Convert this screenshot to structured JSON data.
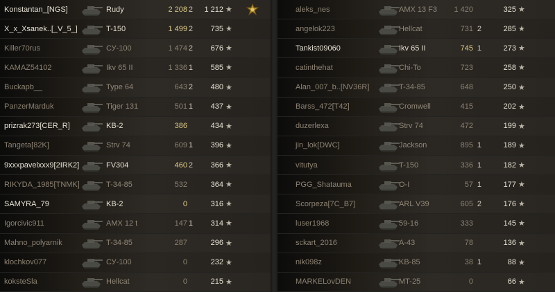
{
  "star_glyph": "★",
  "team_left": [
    {
      "player": "Konstantan_[NGS]",
      "tank": "Rudy",
      "damage": "2 208",
      "kills": "2",
      "xp": "1 212",
      "style": "bright",
      "medal": "ace-medal-icon"
    },
    {
      "player": "X_x_Xsanek..[_V_5_]",
      "tank": "T-150",
      "damage": "1 499",
      "kills": "2",
      "xp": "735",
      "style": "bright"
    },
    {
      "player": "Killer70rus",
      "tank": "СУ-100",
      "damage": "1 474",
      "kills": "2",
      "xp": "676",
      "style": "dim"
    },
    {
      "player": "KAMAZ54102",
      "tank": "Ikv 65 II",
      "damage": "1 336",
      "kills": "1",
      "xp": "585",
      "style": "dim"
    },
    {
      "player": "Buckapb__",
      "tank": "Type 64",
      "damage": "643",
      "kills": "2",
      "xp": "480",
      "style": "dim"
    },
    {
      "player": "PanzerMarduk",
      "tank": "Tiger 131",
      "damage": "501",
      "kills": "1",
      "xp": "437",
      "style": "dim"
    },
    {
      "player": "prizrak273[CER_R]",
      "tank": "KB-2",
      "damage": "386",
      "kills": "",
      "xp": "434",
      "style": "bright"
    },
    {
      "player": "Tangeta[82K]",
      "tank": "Strv 74",
      "damage": "609",
      "kills": "1",
      "xp": "396",
      "style": "dim"
    },
    {
      "player": "9xxxpavelxxx9[2IRK2]",
      "tank": "FV304",
      "damage": "460",
      "kills": "2",
      "xp": "366",
      "style": "bright"
    },
    {
      "player": "RIKYDA_1985[TNMK]",
      "tank": "T-34-85",
      "damage": "532",
      "kills": "",
      "xp": "364",
      "style": "dim"
    },
    {
      "player": "SAMYRA_79",
      "tank": "KB-2",
      "damage": "0",
      "kills": "",
      "xp": "316",
      "style": "bright"
    },
    {
      "player": "Igorcivic911",
      "tank": "AMX 12 t",
      "damage": "147",
      "kills": "1",
      "xp": "314",
      "style": "dim"
    },
    {
      "player": "Mahno_polyarnik",
      "tank": "T-34-85",
      "damage": "287",
      "kills": "",
      "xp": "296",
      "style": "dim"
    },
    {
      "player": "klochkov077",
      "tank": "СУ-100",
      "damage": "0",
      "kills": "",
      "xp": "232",
      "style": "dim"
    },
    {
      "player": "koksteSla",
      "tank": "Hellcat",
      "damage": "0",
      "kills": "",
      "xp": "215",
      "style": "dim"
    }
  ],
  "team_right": [
    {
      "player": "aleks_nes",
      "tank": "AMX 13 F3",
      "damage": "1 420",
      "kills": "",
      "xp": "325",
      "style": "dim"
    },
    {
      "player": "angelok223",
      "tank": "Hellcat",
      "damage": "731",
      "kills": "2",
      "xp": "285",
      "style": "dim"
    },
    {
      "player": "Tankist09060",
      "tank": "Ikv 65 II",
      "damage": "745",
      "kills": "1",
      "xp": "273",
      "style": "bright"
    },
    {
      "player": "catinthehat",
      "tank": "Chi-To",
      "damage": "723",
      "kills": "",
      "xp": "258",
      "style": "dim"
    },
    {
      "player": "Alan_007_b..[NV36R]",
      "tank": "T-34-85",
      "damage": "648",
      "kills": "",
      "xp": "250",
      "style": "dim"
    },
    {
      "player": "Barss_472[T42]",
      "tank": "Cromwell",
      "damage": "415",
      "kills": "",
      "xp": "202",
      "style": "dim"
    },
    {
      "player": "duzerlexa",
      "tank": "Strv 74",
      "damage": "472",
      "kills": "",
      "xp": "199",
      "style": "dim"
    },
    {
      "player": "jin_lok[DWC]",
      "tank": "Jackson",
      "damage": "895",
      "kills": "1",
      "xp": "189",
      "style": "dim"
    },
    {
      "player": "vitutya",
      "tank": "T-150",
      "damage": "336",
      "kills": "1",
      "xp": "182",
      "style": "dim"
    },
    {
      "player": "PGG_Shatauma",
      "tank": "O-I",
      "damage": "57",
      "kills": "1",
      "xp": "177",
      "style": "dim"
    },
    {
      "player": "Scorpeza[7C_B7]",
      "tank": "ARL V39",
      "damage": "605",
      "kills": "2",
      "xp": "176",
      "style": "dim"
    },
    {
      "player": "luser1968",
      "tank": "59-16",
      "damage": "333",
      "kills": "",
      "xp": "145",
      "style": "dim"
    },
    {
      "player": "sckart_2016",
      "tank": "A-43",
      "damage": "78",
      "kills": "",
      "xp": "136",
      "style": "dim"
    },
    {
      "player": "nik098z",
      "tank": "KB-85",
      "damage": "38",
      "kills": "1",
      "xp": "88",
      "style": "dim"
    },
    {
      "player": "MARKELovDEN",
      "tank": "MT-25",
      "damage": "0",
      "kills": "",
      "xp": "66",
      "style": "dim"
    }
  ]
}
